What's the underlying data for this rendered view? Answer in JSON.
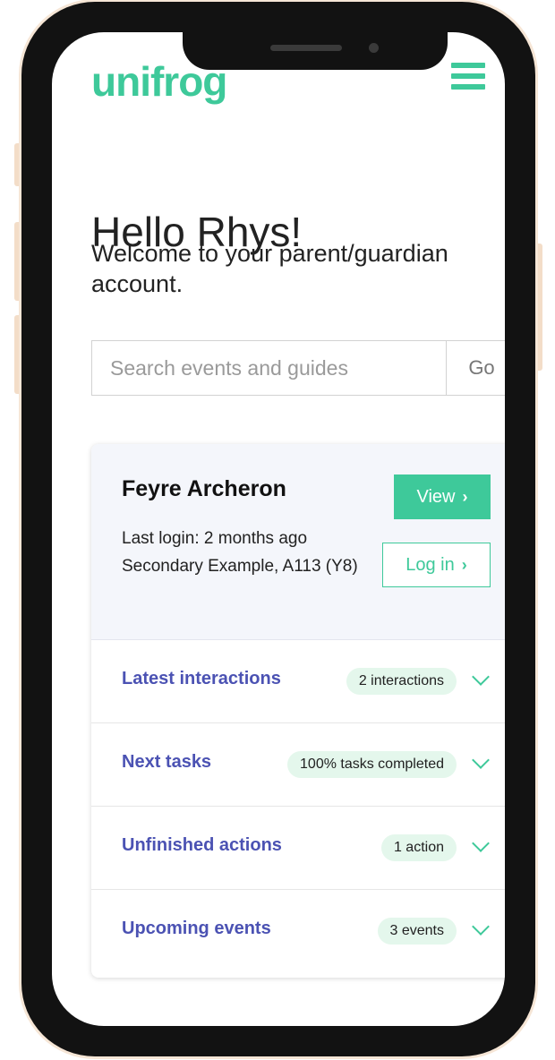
{
  "app": {
    "logo": "unifrog"
  },
  "greeting": {
    "title": "Hello Rhys!",
    "subtitle": "Welcome to your parent/guardian account."
  },
  "search": {
    "placeholder": "Search events and guides",
    "button_label": "Go"
  },
  "student": {
    "name": "Feyre Archeron",
    "last_login": "Last login: 2 months ago",
    "school": "Secondary Example, A113 (Y8)",
    "view_label": "View",
    "login_label": "Log in"
  },
  "sections": [
    {
      "label": "Latest interactions",
      "badge": "2 interactions"
    },
    {
      "label": "Next tasks",
      "badge": "100% tasks completed"
    },
    {
      "label": "Unfinished actions",
      "badge": "1 action"
    },
    {
      "label": "Upcoming events",
      "badge": "3 events"
    }
  ],
  "colors": {
    "accent": "#3ec99a",
    "link": "#4b52b3",
    "badge_bg": "#e4f7ec",
    "card_header_bg": "#f4f6fb"
  }
}
